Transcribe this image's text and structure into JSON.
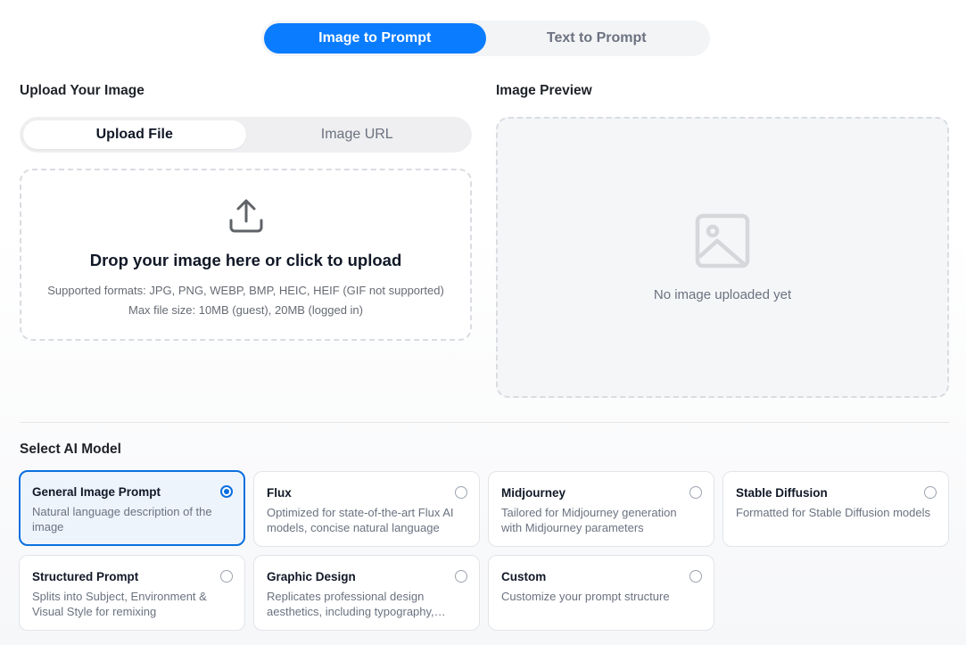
{
  "mode_toggle": {
    "image_to_prompt": "Image to Prompt",
    "text_to_prompt": "Text to Prompt"
  },
  "upload": {
    "title": "Upload Your Image",
    "tabs": {
      "upload_file": "Upload File",
      "image_url": "Image URL"
    },
    "drop_title": "Drop your image here or click to upload",
    "formats": "Supported formats: JPG, PNG, WEBP, BMP, HEIC, HEIF (GIF not supported)",
    "max_size": "Max file size: 10MB (guest), 20MB (logged in)",
    "icon": "upload-icon"
  },
  "preview": {
    "title": "Image Preview",
    "empty_text": "No image uploaded yet",
    "icon": "image-placeholder-icon"
  },
  "models": {
    "title": "Select AI Model",
    "selected": "General Image Prompt",
    "items": [
      {
        "name": "General Image Prompt",
        "desc": "Natural language description of the image"
      },
      {
        "name": "Flux",
        "desc": "Optimized for state-of-the-art Flux AI models, concise natural language"
      },
      {
        "name": "Midjourney",
        "desc": "Tailored for Midjourney generation with Midjourney parameters"
      },
      {
        "name": "Stable Diffusion",
        "desc": "Formatted for Stable Diffusion models"
      },
      {
        "name": "Structured Prompt",
        "desc": "Splits into Subject, Environment & Visual Style for remixing"
      },
      {
        "name": "Graphic Design",
        "desc": "Replicates professional design aesthetics, including typography, layout and color"
      },
      {
        "name": "Custom",
        "desc": "Customize your prompt structure"
      }
    ]
  },
  "colors": {
    "accent": "#0a7cff",
    "selected_border": "#0a6fe0",
    "selected_bg": "#eef4fc"
  }
}
